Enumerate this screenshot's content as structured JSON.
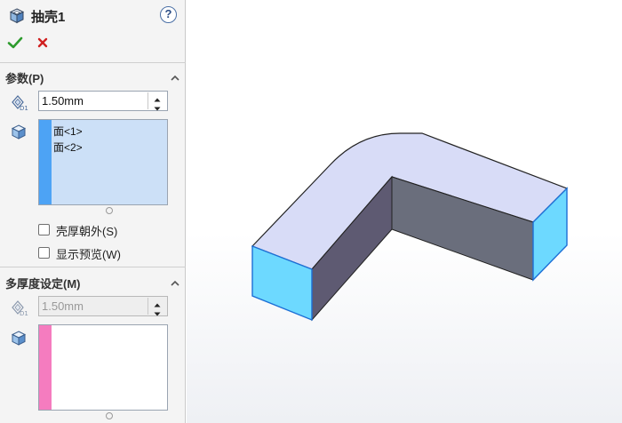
{
  "feature": {
    "title": "抽壳1",
    "help_label": "?"
  },
  "actions": {
    "ok_icon": "checkmark-icon",
    "cancel_icon": "x-icon"
  },
  "parameters": {
    "section_title": "参数(P)",
    "thickness": "1.50mm",
    "faces": [
      "面<1>",
      "面<2>"
    ],
    "shell_outward_label": "壳厚朝外(S)",
    "show_preview_label": "显示预览(W)",
    "shell_outward_checked": false,
    "show_preview_checked": false
  },
  "multi_thickness": {
    "section_title": "多厚度设定(M)",
    "thickness": "1.50mm",
    "faces": []
  },
  "colors": {
    "faces_bar": "#4da3f5",
    "multi_faces_bar": "#f57cbf",
    "removed_face": "#6dd9ff",
    "top_face": "#d8dcf7",
    "inner_face_dark": "#5a5a6e"
  }
}
